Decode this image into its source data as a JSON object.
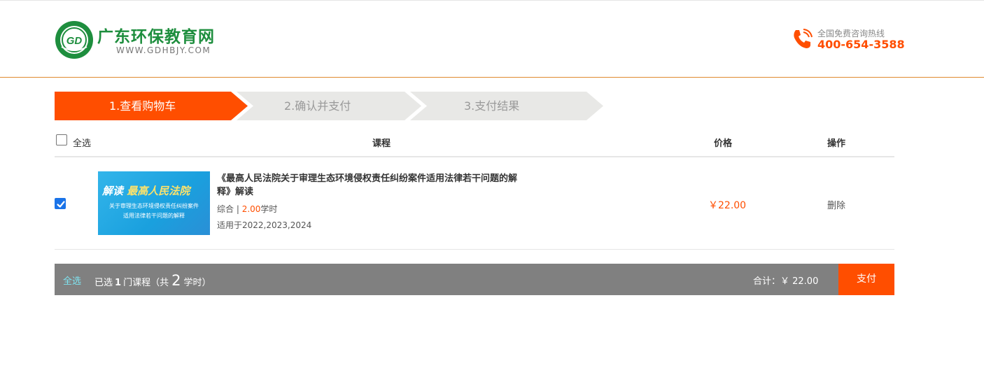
{
  "header": {
    "logo_title": "广东环保教育网",
    "logo_url": "WWW.GDHBJY.COM",
    "hotline_label": "全国免费咨询热线",
    "hotline_number": "400-654-3588"
  },
  "steps": [
    {
      "label": "1.查看购物车",
      "active": true
    },
    {
      "label": "2.确认并支付",
      "active": false
    },
    {
      "label": "3.支付结果",
      "active": false
    }
  ],
  "table": {
    "select_all_label": "全选",
    "col_course": "课程",
    "col_price": "价格",
    "col_ops": "操作"
  },
  "items": [
    {
      "checked": true,
      "thumb_prefix": "解读",
      "thumb_highlight": "最高人民法院",
      "thumb_line1": "关于审理生态环境侵权责任纠纷案件",
      "thumb_line2": "适用法律若干问题的解释",
      "title": "《最高人民法院关于审理生态环境侵权责任纠纷案件适用法律若干问题的解释》解读",
      "category": "综合 | ",
      "hours": "2.00",
      "hours_unit": "学时",
      "years": "适用于2022,2023,2024",
      "price": "￥22.00",
      "delete_label": "删除"
    }
  ],
  "footer": {
    "select_all_label": "全选",
    "summary_prefix": "已选",
    "selected_count": "1",
    "summary_mid": "门课程（共",
    "total_hours": "2",
    "summary_suffix": "学时）",
    "total_label": "合计：￥ 22.00",
    "pay_label": "支付"
  },
  "colors": {
    "accent": "#ff4e00",
    "brand_green": "#1e8e3e",
    "bar_gray": "#808080",
    "step_inactive": "#e8e8e6"
  }
}
